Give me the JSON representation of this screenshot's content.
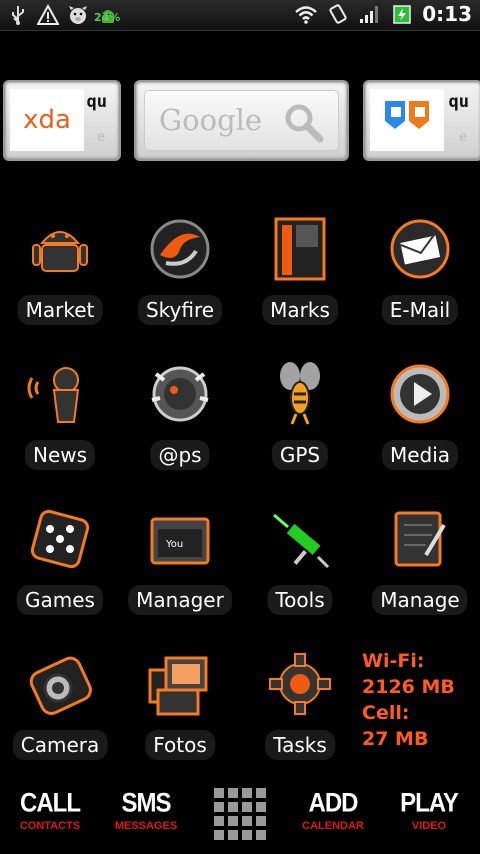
{
  "status_bar": {
    "battery_badge": "24%",
    "clock": "0:13"
  },
  "widgets": {
    "xda": {
      "logo_text": "xda",
      "side_text": "qu",
      "small_text": "e"
    },
    "google": {
      "text": "Google"
    },
    "app": {
      "side_text": "qu",
      "small_text": "e"
    }
  },
  "apps": [
    {
      "label": "Market",
      "icon": "android-icon"
    },
    {
      "label": "Skyfire",
      "icon": "skyfire-icon"
    },
    {
      "label": "Marks",
      "icon": "bookmark-icon"
    },
    {
      "label": "E-Mail",
      "icon": "mail-icon"
    },
    {
      "label": "News",
      "icon": "news-icon"
    },
    {
      "label": "@ps",
      "icon": "apps-icon"
    },
    {
      "label": "GPS",
      "icon": "gps-icon"
    },
    {
      "label": "Media",
      "icon": "media-play-icon"
    },
    {
      "label": "Games",
      "icon": "dice-icon"
    },
    {
      "label": "Manager",
      "icon": "folder-icon"
    },
    {
      "label": "Tools",
      "icon": "syringe-icon"
    },
    {
      "label": "Manage",
      "icon": "notepad-icon"
    },
    {
      "label": "Camera",
      "icon": "camera-icon"
    },
    {
      "label": "Fotos",
      "icon": "photos-icon"
    },
    {
      "label": "Tasks",
      "icon": "gear-icon"
    }
  ],
  "data_usage": {
    "wifi_label": "Wi-Fi:",
    "wifi_value": "2126 MB",
    "cell_label": "Cell:",
    "cell_value": "27 MB"
  },
  "dock": {
    "call": {
      "main": "CALL",
      "sub": "CONTACTS"
    },
    "sms": {
      "main": "SMS",
      "sub": "MESSAGES"
    },
    "add": {
      "main": "ADD",
      "sub": "CALENDAR"
    },
    "play": {
      "main": "PLAY",
      "sub": "VIDEO"
    }
  },
  "colors": {
    "accent": "#ff5a1f",
    "dock_sub": "#e01818"
  }
}
